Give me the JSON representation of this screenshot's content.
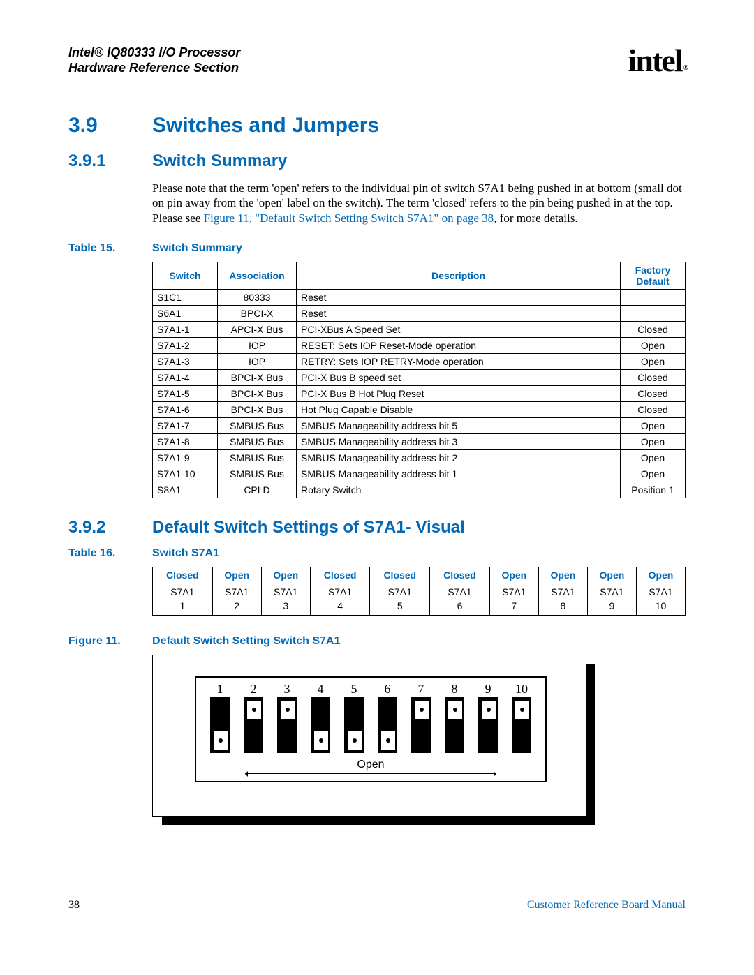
{
  "header": {
    "product": "Intel® IQ80333 I/O Processor",
    "section": "Hardware Reference Section",
    "logo_text": "intel",
    "logo_reg": "®"
  },
  "sec39": {
    "num": "3.9",
    "title": "Switches and Jumpers"
  },
  "sec391": {
    "num": "3.9.1",
    "title": "Switch Summary"
  },
  "intro": {
    "p1a": "Please note that the term 'open' refers to the individual pin of switch S7A1 being pushed in at bottom (small dot on pin away from the 'open' label on the switch). The term 'closed' refers to the pin being pushed in at the top. Please see ",
    "link": "Figure 11, \"Default Switch Setting Switch S7A1\" on page 38",
    "p1b": ", for more details."
  },
  "table15": {
    "caption_num": "Table 15.",
    "caption_title": "Switch Summary",
    "headers": {
      "c1": "Switch",
      "c2": "Association",
      "c3": "Description",
      "c4a": "Factory",
      "c4b": "Default"
    },
    "rows": [
      {
        "sw": "S1C1",
        "assoc": "80333",
        "desc": "Reset",
        "def": ""
      },
      {
        "sw": "S6A1",
        "assoc": "BPCI-X",
        "desc": "Reset",
        "def": ""
      },
      {
        "sw": "S7A1-1",
        "assoc": "APCI-X Bus",
        "desc": "PCI-XBus A Speed Set",
        "def": "Closed"
      },
      {
        "sw": "S7A1-2",
        "assoc": "IOP",
        "desc": "RESET: Sets IOP Reset-Mode operation",
        "def": "Open"
      },
      {
        "sw": "S7A1-3",
        "assoc": "IOP",
        "desc": "RETRY: Sets IOP RETRY-Mode operation",
        "def": "Open"
      },
      {
        "sw": "S7A1-4",
        "assoc": "BPCI-X Bus",
        "desc": "PCI-X Bus B speed set",
        "def": "Closed"
      },
      {
        "sw": "S7A1-5",
        "assoc": "BPCI-X Bus",
        "desc": "PCI-X Bus B Hot Plug Reset",
        "def": "Closed"
      },
      {
        "sw": "S7A1-6",
        "assoc": "BPCI-X Bus",
        "desc": "Hot Plug Capable Disable",
        "def": "Closed"
      },
      {
        "sw": "S7A1-7",
        "assoc": "SMBUS Bus",
        "desc": "SMBUS Manageability address bit 5",
        "def": "Open"
      },
      {
        "sw": "S7A1-8",
        "assoc": "SMBUS Bus",
        "desc": "SMBUS Manageability address bit 3",
        "def": "Open"
      },
      {
        "sw": "S7A1-9",
        "assoc": "SMBUS Bus",
        "desc": "SMBUS Manageability address bit 2",
        "def": "Open"
      },
      {
        "sw": "S7A1-10",
        "assoc": "SMBUS Bus",
        "desc": "SMBUS Manageability address bit 1",
        "def": "Open"
      },
      {
        "sw": "S8A1",
        "assoc": "CPLD",
        "desc": "Rotary Switch",
        "def": "Position 1"
      }
    ]
  },
  "sec392": {
    "num": "3.9.2",
    "title": "Default Switch Settings of S7A1- Visual"
  },
  "table16": {
    "caption_num": "Table 16.",
    "caption_title": "Switch S7A1",
    "headers": [
      "Closed",
      "Open",
      "Open",
      "Closed",
      "Closed",
      "Closed",
      "Open",
      "Open",
      "Open",
      "Open"
    ],
    "row_label": "S7A1",
    "nums": [
      "1",
      "2",
      "3",
      "4",
      "5",
      "6",
      "7",
      "8",
      "9",
      "10"
    ]
  },
  "figure11": {
    "caption_num": "Figure 11.",
    "caption_title": "Default Switch Setting Switch S7A1",
    "open_label": "Open",
    "positions": [
      {
        "n": "1",
        "state": "down"
      },
      {
        "n": "2",
        "state": "up"
      },
      {
        "n": "3",
        "state": "up"
      },
      {
        "n": "4",
        "state": "down"
      },
      {
        "n": "5",
        "state": "down"
      },
      {
        "n": "6",
        "state": "down"
      },
      {
        "n": "7",
        "state": "up"
      },
      {
        "n": "8",
        "state": "up"
      },
      {
        "n": "9",
        "state": "up"
      },
      {
        "n": "10",
        "state": "up"
      }
    ]
  },
  "footer": {
    "page": "38",
    "doc": "Customer Reference Board Manual"
  }
}
